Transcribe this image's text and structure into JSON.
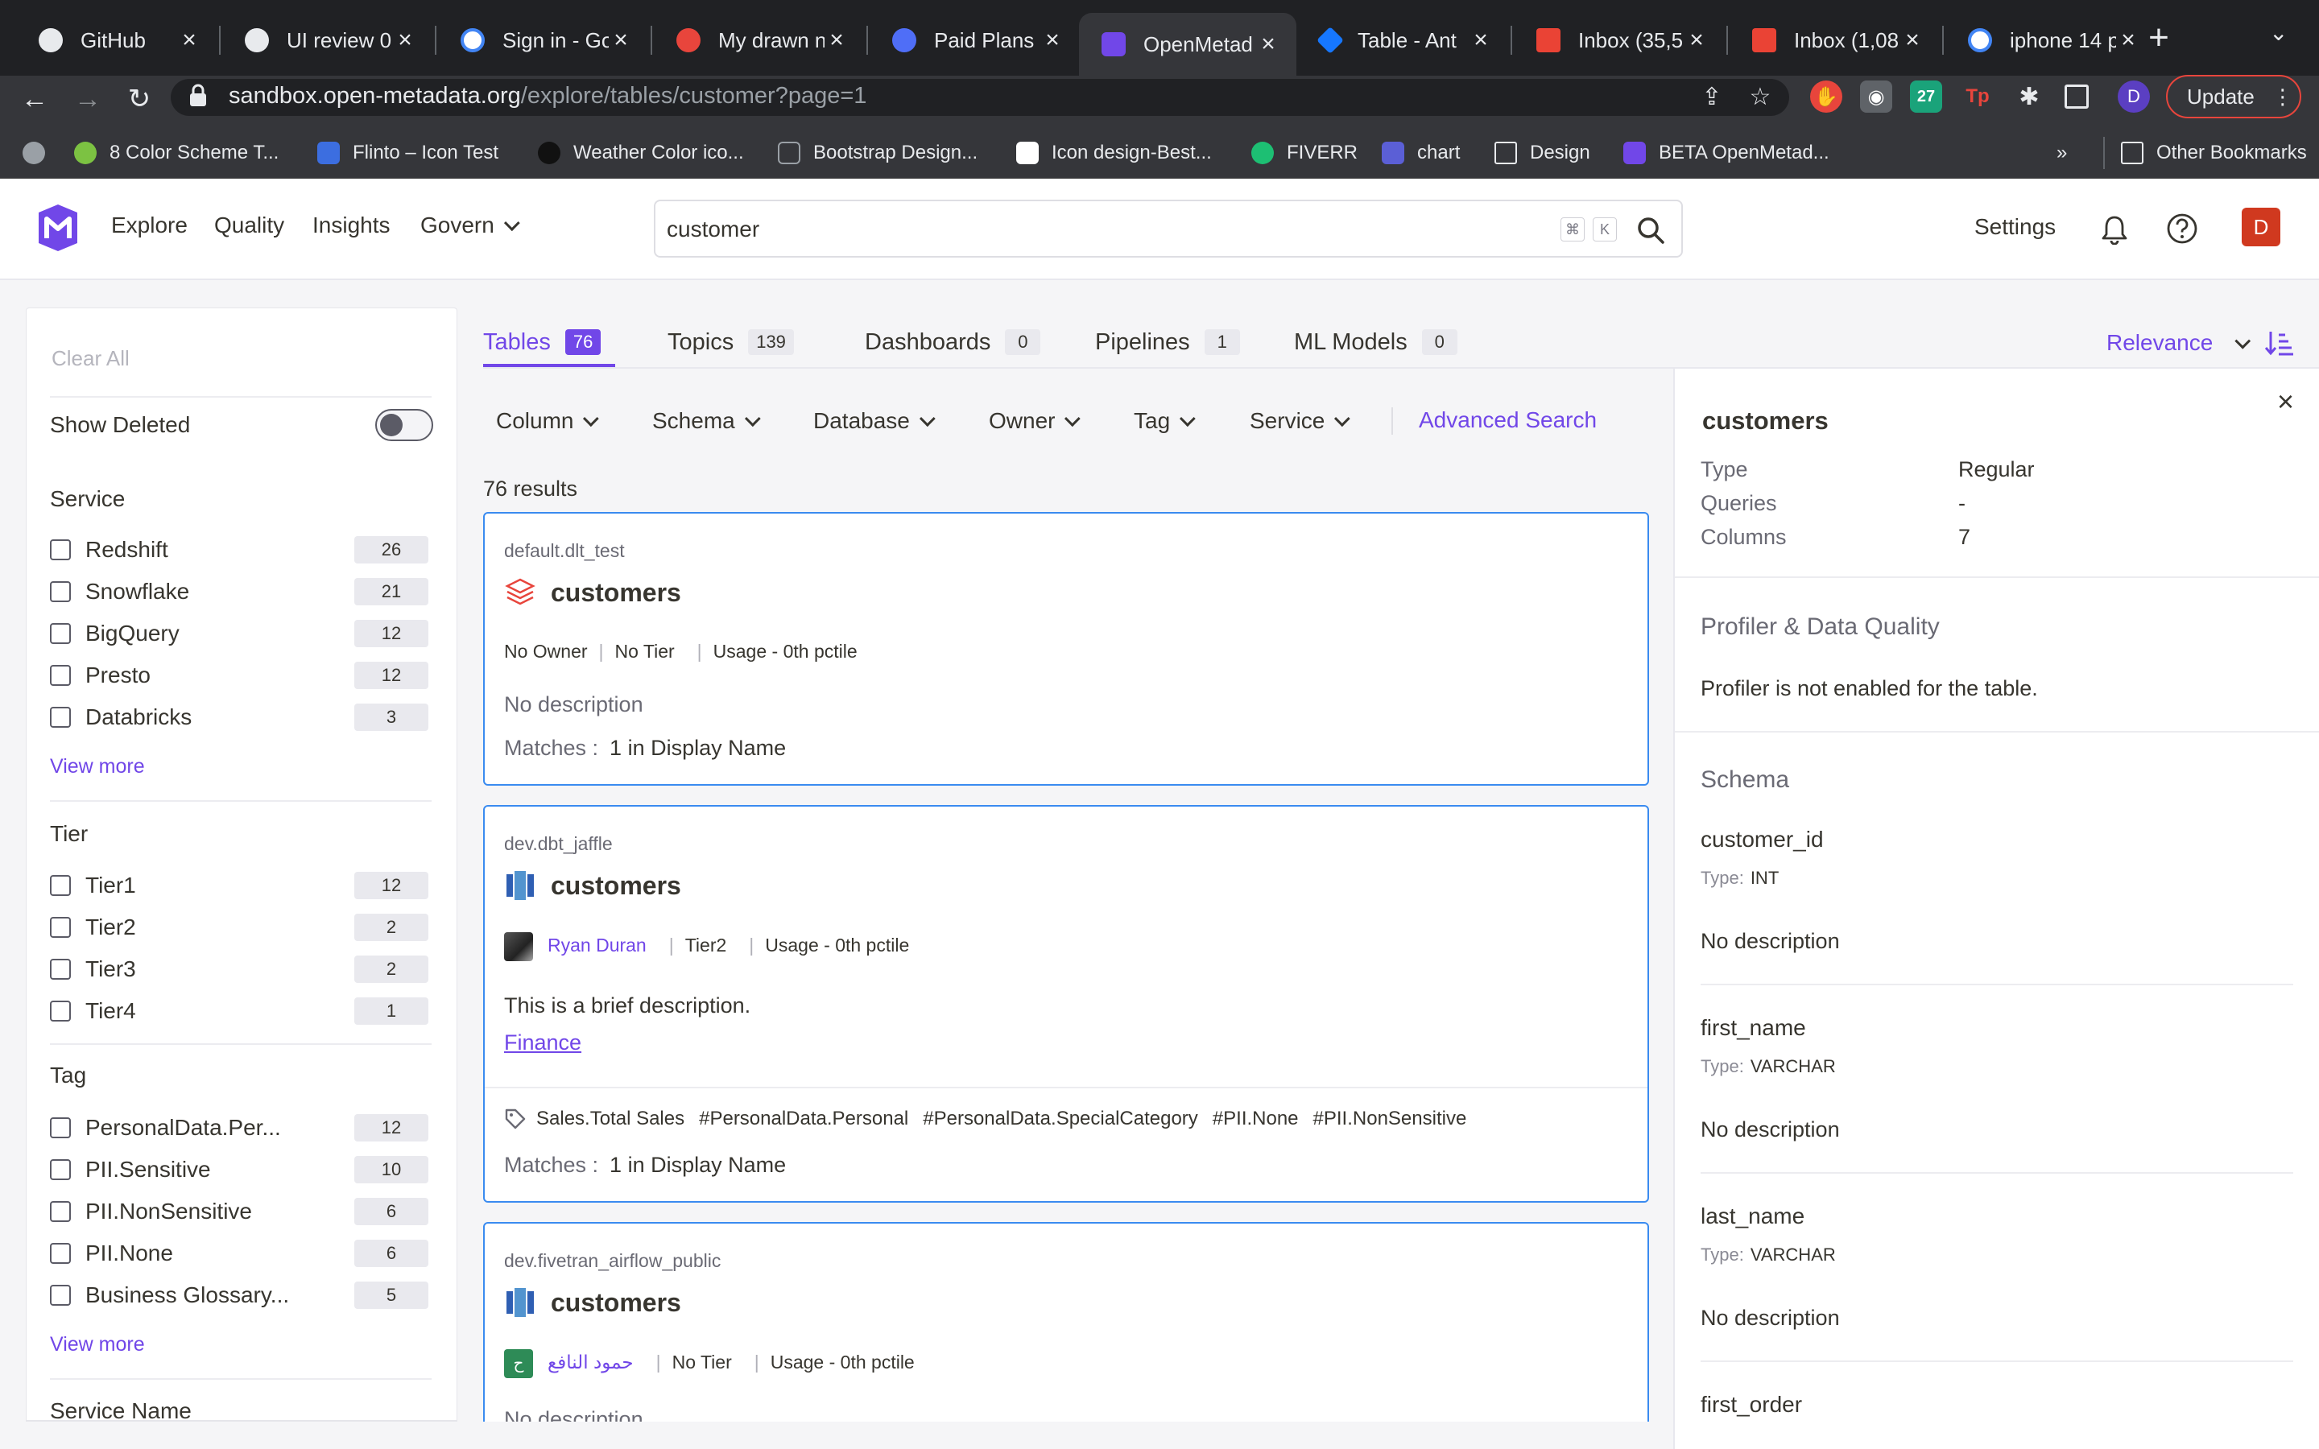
{
  "browser": {
    "tabs": [
      {
        "label": "GitHub",
        "icon": "github-icon"
      },
      {
        "label": "UI review 0",
        "icon": "github-icon"
      },
      {
        "label": "Sign in - Go",
        "icon": "google-icon"
      },
      {
        "label": "My drawn n",
        "icon": "figma-icon"
      },
      {
        "label": "Paid Plans",
        "icon": "gear-icon"
      },
      {
        "label": "OpenMetad",
        "icon": "openmetadata-icon"
      },
      {
        "label": "Table - Ant",
        "icon": "antd-icon"
      },
      {
        "label": "Inbox (35,5",
        "icon": "gmail-icon"
      },
      {
        "label": "Inbox (1,08",
        "icon": "gmail-icon"
      },
      {
        "label": "iphone 14 p",
        "icon": "google-icon"
      }
    ],
    "url_host": "sandbox.open-metadata.org",
    "url_path": "/explore/tables/customer?page=1",
    "profile_initial": "D",
    "update_label": "Update",
    "bookmarks": [
      "8 Color Scheme T...",
      "Flinto – Icon Test",
      "Weather Color ico...",
      "Bootstrap Design...",
      "Icon design-Best...",
      "FIVERR",
      "chart",
      "Design",
      "BETA OpenMetad..."
    ],
    "bookmarks_more": "»",
    "other_bookmarks": "Other Bookmarks"
  },
  "header": {
    "nav": [
      "Explore",
      "Quality",
      "Insights",
      "Govern"
    ],
    "search_value": "customer",
    "kbd_cmd": "⌘",
    "kbd_k": "K",
    "settings": "Settings",
    "user_initial": "D"
  },
  "filters": {
    "clear_all": "Clear All",
    "show_deleted": "Show Deleted",
    "sections": [
      {
        "title": "Service",
        "items": [
          {
            "label": "Redshift",
            "count": "26"
          },
          {
            "label": "Snowflake",
            "count": "21"
          },
          {
            "label": "BigQuery",
            "count": "12"
          },
          {
            "label": "Presto",
            "count": "12"
          },
          {
            "label": "Databricks",
            "count": "3"
          }
        ]
      },
      {
        "title": "Tier",
        "items": [
          {
            "label": "Tier1",
            "count": "12"
          },
          {
            "label": "Tier2",
            "count": "2"
          },
          {
            "label": "Tier3",
            "count": "2"
          },
          {
            "label": "Tier4",
            "count": "1"
          }
        ]
      },
      {
        "title": "Tag",
        "items": [
          {
            "label": "PersonalData.Per...",
            "count": "12"
          },
          {
            "label": "PII.Sensitive",
            "count": "10"
          },
          {
            "label": "PII.NonSensitive",
            "count": "6"
          },
          {
            "label": "PII.None",
            "count": "6"
          },
          {
            "label": "Business Glossary...",
            "count": "5"
          }
        ]
      }
    ],
    "view_more": "View more",
    "service_name": "Service Name"
  },
  "explore": {
    "tabs": [
      {
        "label": "Tables",
        "count": "76"
      },
      {
        "label": "Topics",
        "count": "139"
      },
      {
        "label": "Dashboards",
        "count": "0"
      },
      {
        "label": "Pipelines",
        "count": "1"
      },
      {
        "label": "ML Models",
        "count": "0"
      }
    ],
    "sort_label": "Relevance",
    "dropdowns": [
      "Column",
      "Schema",
      "Database",
      "Owner",
      "Tag",
      "Service"
    ],
    "advanced_search": "Advanced Search",
    "results_count": "76 results"
  },
  "results": [
    {
      "fqn": "default.dlt_test",
      "title": "customers",
      "owner": "No Owner",
      "tier": "No Tier",
      "usage": "Usage - 0th pctile",
      "description": "No description",
      "matches_label": "Matches :",
      "matches_value": "1 in Display Name"
    },
    {
      "fqn": "dev.dbt_jaffle",
      "title": "customers",
      "owner": "Ryan Duran",
      "tier": "Tier2",
      "usage": "Usage - 0th pctile",
      "description": "This is a brief description.",
      "glossary_link": "Finance",
      "tags": [
        "Sales.Total Sales",
        "#PersonalData.Personal",
        "#PersonalData.SpecialCategory",
        "#PII.None",
        "#PII.NonSensitive"
      ],
      "matches_label": "Matches :",
      "matches_value": "1 in Display Name"
    },
    {
      "fqn": "dev.fivetran_airflow_public",
      "title": "customers",
      "owner_initial": "ح",
      "owner": "حمود النافع",
      "tier": "No Tier",
      "usage": "Usage - 0th pctile",
      "description": "No description"
    }
  ],
  "panel": {
    "title": "customers",
    "props": [
      {
        "key": "Type",
        "value": "Regular"
      },
      {
        "key": "Queries",
        "value": "-"
      },
      {
        "key": "Columns",
        "value": "7"
      }
    ],
    "profiler_title": "Profiler & Data Quality",
    "profiler_text": "Profiler is not enabled for the table.",
    "schema_title": "Schema",
    "type_key": "Type:",
    "columns": [
      {
        "name": "customer_id",
        "type": "INT",
        "description": "No description"
      },
      {
        "name": "first_name",
        "type": "VARCHAR",
        "description": "No description"
      },
      {
        "name": "last_name",
        "type": "VARCHAR",
        "description": "No description"
      },
      {
        "name": "first_order"
      }
    ]
  },
  "colors": {
    "accent": "#7147e8",
    "card_border": "#3a8bf0",
    "avatar_bg": "#d0391f"
  }
}
